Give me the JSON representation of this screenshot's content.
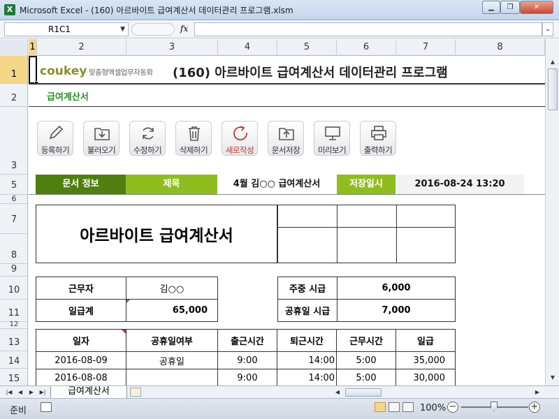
{
  "window": {
    "title": "Microsoft Excel - (160) 아르바이트 급여계산서 데이터관리 프로그램.xlsm",
    "app_icon": "X",
    "buttons": [
      "minimize",
      "restore",
      "close"
    ]
  },
  "formula_bar": {
    "name_box": "R1C1",
    "fx_label": "fx",
    "formula": ""
  },
  "columns": [
    "1",
    "2",
    "3",
    "4",
    "5",
    "6",
    "7",
    "8"
  ],
  "rows": [
    "1",
    "2",
    "3",
    "5",
    "6",
    "7",
    "8",
    "9",
    "10",
    "11",
    "12",
    "13",
    "14",
    "15"
  ],
  "header": {
    "logo": "coukey",
    "logo_tagline": "맞춤형엑셀업무자동화",
    "title": "(160) 아르바이트 급여계산서 데이터관리 프로그램",
    "subtitle": "급여계산서"
  },
  "toolbar": [
    {
      "label": "등록하기",
      "icon": "pencil-icon"
    },
    {
      "label": "불러오기",
      "icon": "folder-download-icon"
    },
    {
      "label": "수정하기",
      "icon": "refresh-icon"
    },
    {
      "label": "삭제하기",
      "icon": "trash-icon"
    },
    {
      "label": "새로작성",
      "icon": "new-circle-icon",
      "accent": "#c0392b"
    },
    {
      "label": "문서저장",
      "icon": "folder-upload-icon"
    },
    {
      "label": "미리보기",
      "icon": "monitor-icon"
    },
    {
      "label": "출력하기",
      "icon": "printer-icon"
    }
  ],
  "info_bar": {
    "doc_info_label": "문서 정보",
    "title_label": "제목",
    "title_value": "4월 김○○ 급여계산서",
    "saved_label": "저장일시",
    "saved_value": "2016-08-24 13:20",
    "colors": {
      "dark": "#4f7f10",
      "light": "#8fbd1f"
    }
  },
  "document": {
    "title": "아르바이트 급여계산서",
    "worker_label": "근무자",
    "worker_value": "김○○",
    "pay_total_label": "일급계",
    "pay_total_value": "65,000",
    "weekly_rate_label": "주중 시급",
    "weekly_rate_value": "6,000",
    "holiday_rate_label": "공휴일 시급",
    "holiday_rate_value": "7,000"
  },
  "table": {
    "headers": [
      "일자",
      "공휴일여부",
      "출근시간",
      "퇴근시간",
      "근무시간",
      "일급"
    ],
    "rows": [
      [
        "2016-08-09",
        "공휴일",
        "9:00",
        "14:00",
        "5:00",
        "35,000"
      ],
      [
        "2016-08-08",
        "",
        "9:00",
        "14:00",
        "5:00",
        "30,000"
      ]
    ]
  },
  "sheet_tabs": {
    "active": "급여계산서"
  },
  "status_bar": {
    "status": "준비",
    "zoom": "100%",
    "zoom_minus": "−",
    "zoom_plus": "+"
  }
}
